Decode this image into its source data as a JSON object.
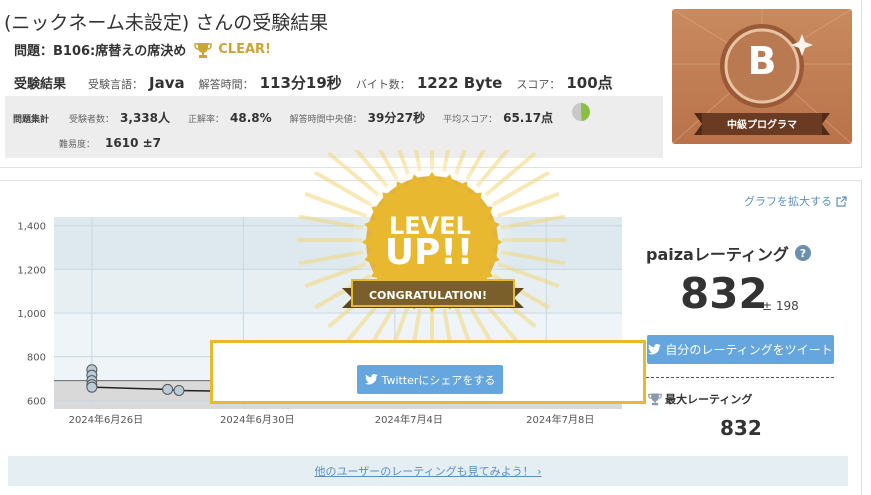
{
  "header": {
    "title": "(ニックネーム未設定) さんの受験結果",
    "problem": "問題：B106:席替えの席決め",
    "clear": "CLEAR!"
  },
  "result": {
    "heading": "受験結果",
    "lang_label": "受験言語：",
    "lang": "Java",
    "time_label": "解答時間：",
    "time": "113分19秒",
    "bytes_label": "バイト数：",
    "bytes": "1222 Byte",
    "score_label": "スコア：",
    "score": "100点"
  },
  "stats": {
    "heading": "問題集計",
    "examinees_label": "受験者数：",
    "examinees": "3,338人",
    "accuracy_label": "正解率：",
    "accuracy": "48.8%",
    "accuracy_fraction": 0.488,
    "median_label": "解答時間中央値：",
    "median": "39分27秒",
    "avg_label": "平均スコア：",
    "avg": "65.17点",
    "difficulty_label": "難易度：",
    "difficulty": "1610 ±7"
  },
  "badge": {
    "rank": "B",
    "label": "中級プログラマ"
  },
  "graph": {
    "enlarge": "グラフを拡大する"
  },
  "chart_data": {
    "type": "line",
    "x_ticks": [
      "2024年6月26日",
      "2024年6月30日",
      "2024年7月4日",
      "2024年7月8日"
    ],
    "y_ticks": [
      "600",
      "800",
      "1,000",
      "1,200",
      "1,400"
    ],
    "ylim": [
      560,
      1440
    ],
    "xlim": [
      "2024-06-25",
      "2024-07-10"
    ],
    "line": {
      "x": [
        "2024-06-26",
        "2024-06-28",
        "2024-06-28.3",
        "2024-06-30"
      ],
      "y": [
        660,
        650,
        645,
        640
      ]
    },
    "points": [
      {
        "x": "2024-06-26",
        "y": 740
      },
      {
        "x": "2024-06-26",
        "y": 715
      },
      {
        "x": "2024-06-26",
        "y": 690
      },
      {
        "x": "2024-06-26",
        "y": 672
      },
      {
        "x": "2024-06-26",
        "y": 660
      },
      {
        "x": "2024-06-28",
        "y": 650
      },
      {
        "x": "2024-06-28.3",
        "y": 645
      },
      {
        "x": "2024-07-09.5",
        "y": 832
      }
    ],
    "grid": true
  },
  "rating": {
    "title": "paizaレーティング",
    "value": "832",
    "deviation": "± 198",
    "tweet_label": "自分のレーティングをツイート",
    "max_label": "最大レーティング",
    "max_value": "832"
  },
  "levelup": {
    "line1": "LEVEL",
    "line2": "UP!!",
    "congrats": "CONGRATULATION!",
    "share_label": "Twitterにシェアをする"
  },
  "others_link": "他のユーザーのレーティングも見てみよう！ ›",
  "colors": {
    "gold": "#e8b930",
    "twitter_blue": "#64a6dd",
    "link_blue": "#5a8fc0",
    "bronze": "#c98a5f"
  }
}
